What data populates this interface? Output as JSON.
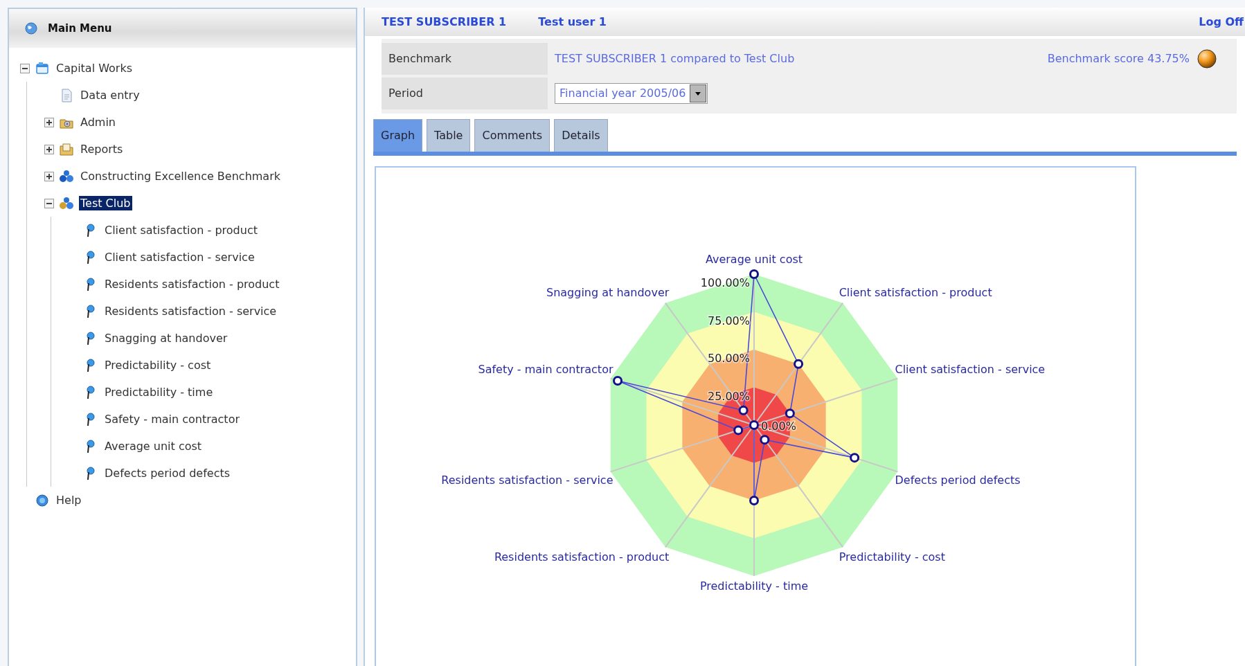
{
  "sidebar": {
    "title": "Main Menu",
    "tree": [
      {
        "label": "Capital Works",
        "kind": "app",
        "expanded": true,
        "selected": false,
        "children": [
          {
            "label": "Data entry",
            "kind": "page",
            "selected": false
          },
          {
            "label": "Admin",
            "kind": "admin",
            "expanded": false,
            "selected": false
          },
          {
            "label": "Reports",
            "kind": "reports",
            "expanded": false,
            "selected": false
          },
          {
            "label": "Constructing Excellence Benchmark",
            "kind": "group",
            "expanded": false,
            "selected": false
          },
          {
            "label": "Test Club",
            "kind": "club",
            "expanded": true,
            "selected": true,
            "children": [
              {
                "label": "Client satisfaction - product",
                "kind": "metric",
                "selected": false
              },
              {
                "label": "Client satisfaction - service",
                "kind": "metric",
                "selected": false
              },
              {
                "label": "Residents satisfaction - product",
                "kind": "metric",
                "selected": false
              },
              {
                "label": "Residents satisfaction - service",
                "kind": "metric",
                "selected": false
              },
              {
                "label": "Snagging at handover",
                "kind": "metric",
                "selected": false
              },
              {
                "label": "Predictability - cost",
                "kind": "metric",
                "selected": false
              },
              {
                "label": "Predictability - time",
                "kind": "metric",
                "selected": false
              },
              {
                "label": "Safety - main contractor",
                "kind": "metric",
                "selected": false
              },
              {
                "label": "Average unit cost",
                "kind": "metric",
                "selected": false
              },
              {
                "label": "Defects period defects",
                "kind": "metric",
                "selected": false
              }
            ]
          }
        ]
      },
      {
        "label": "Help",
        "kind": "help",
        "selected": false
      }
    ]
  },
  "header": {
    "subscriber": "TEST SUBSCRIBER 1",
    "user": "Test user 1",
    "logoff": "Log Off"
  },
  "benchmark": {
    "label": "Benchmark",
    "value": "TEST SUBSCRIBER 1 compared to Test Club",
    "score": "Benchmark score 43.75%"
  },
  "period": {
    "label": "Period",
    "value": "Financial year 2005/06"
  },
  "tabs": [
    {
      "label": "Graph",
      "selected": true
    },
    {
      "label": "Table",
      "selected": false
    },
    {
      "label": "Comments",
      "selected": false
    },
    {
      "label": "Details",
      "selected": false
    }
  ],
  "graph": {
    "chart_data": {
      "type": "radar",
      "categories": [
        "Average unit cost",
        "Client satisfaction - product",
        "Client satisfaction - service",
        "Defects period defects",
        "Predictability - cost",
        "Predictability - time",
        "Residents satisfaction - product",
        "Residents satisfaction - service",
        "Safety - main contractor",
        "Snagging at handover"
      ],
      "ylim": [
        0,
        100
      ],
      "yticks": [
        {
          "value": 0,
          "label": "0.00%"
        },
        {
          "value": 25,
          "label": "25.00%"
        },
        {
          "value": 50,
          "label": "50.00%"
        },
        {
          "value": 75,
          "label": "75.00%"
        },
        {
          "value": 100,
          "label": "100.00%"
        }
      ],
      "series": [
        {
          "color": "#4a4ad8",
          "values": [
            100,
            50,
            25,
            70,
            12,
            50,
            0,
            11,
            95,
            12
          ]
        }
      ]
    }
  }
}
